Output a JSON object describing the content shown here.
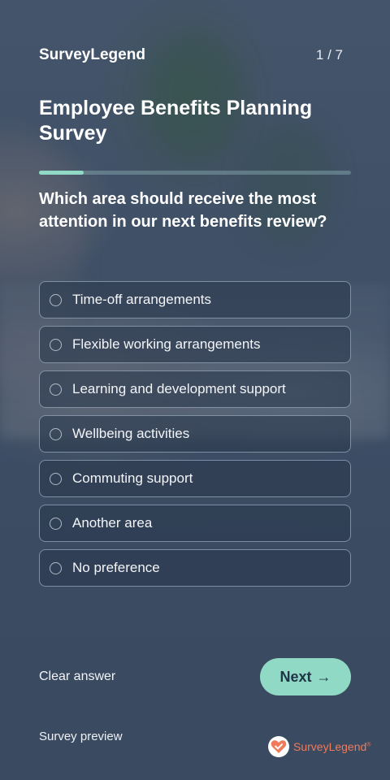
{
  "header": {
    "brand": "SurveyLegend",
    "progress_count": "1 / 7"
  },
  "survey": {
    "title": "Employee Benefits Planning Survey",
    "progress_fraction": 0.143,
    "question": "Which area should receive the most attention in our next benefits review?",
    "options": [
      {
        "label": "Time-off arrangements",
        "selected": false
      },
      {
        "label": "Flexible working arrangements",
        "selected": false
      },
      {
        "label": "Learning and development support",
        "selected": false
      },
      {
        "label": "Wellbeing activities",
        "selected": false
      },
      {
        "label": "Commuting support",
        "selected": false
      },
      {
        "label": "Another area",
        "selected": false
      },
      {
        "label": "No preference",
        "selected": false
      }
    ]
  },
  "actions": {
    "clear_label": "Clear answer",
    "next_label": "Next",
    "next_arrow": "→"
  },
  "footer": {
    "preview_label": "Survey preview",
    "logo_text": "SurveyLegend",
    "logo_reg": "®",
    "logo_icon": "heart-check-icon"
  },
  "colors": {
    "accent": "#8fd9c5",
    "background": "#3d4d63",
    "logo": "#f07a5a"
  }
}
